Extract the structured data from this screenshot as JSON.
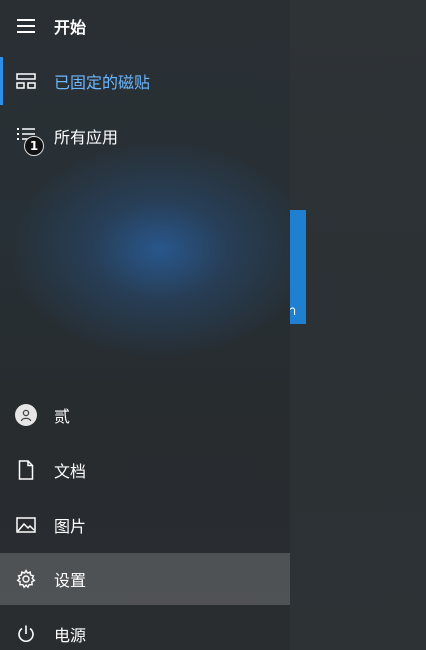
{
  "start_menu": {
    "title": "开始",
    "menu_icon": "hamburger-icon",
    "nav": [
      {
        "label": "已固定的磁贴",
        "icon": "pinned-tiles-icon",
        "selected": true
      },
      {
        "label": "所有应用",
        "icon": "all-apps-list-icon",
        "badge": "1"
      }
    ],
    "bottom": [
      {
        "label": "贰",
        "icon": "user-avatar-icon"
      },
      {
        "label": "文档",
        "icon": "document-icon"
      },
      {
        "label": "图片",
        "icon": "pictures-icon"
      },
      {
        "label": "设置",
        "icon": "gear-icon",
        "highlighted": true
      },
      {
        "label": "电源",
        "icon": "power-icon"
      }
    ]
  },
  "desktop": {
    "tile_glyph": "า"
  },
  "colors": {
    "accent": "#2f8fe8",
    "selected_text": "#6cb8ff",
    "tile_blue": "#1f7fd0"
  }
}
